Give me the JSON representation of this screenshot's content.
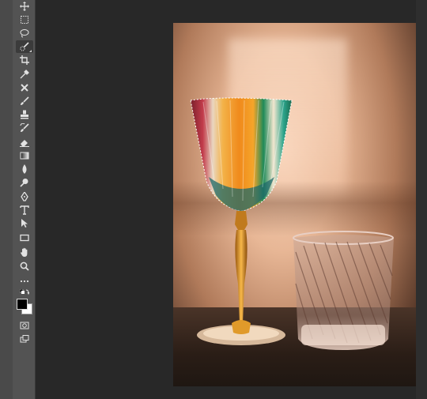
{
  "app": {
    "toolbar": {
      "tools": [
        {
          "name": "move-tool-icon",
          "glyph": "✥"
        },
        {
          "name": "rectangular-marquee-tool-icon",
          "glyph": "⬚"
        },
        {
          "name": "lasso-tool-icon",
          "glyph": "◌"
        },
        {
          "name": "quick-selection-tool-icon",
          "glyph": "✎",
          "active": true
        },
        {
          "name": "crop-tool-icon",
          "glyph": "⌗"
        },
        {
          "name": "eyedropper-tool-icon",
          "glyph": "⁄"
        },
        {
          "name": "spot-healing-brush-tool-icon",
          "glyph": "✗"
        },
        {
          "name": "brush-tool-icon",
          "glyph": "∕"
        },
        {
          "name": "clone-stamp-tool-icon",
          "glyph": "⊥"
        },
        {
          "name": "history-brush-tool-icon",
          "glyph": "↗"
        },
        {
          "name": "eraser-tool-icon",
          "glyph": "◆"
        },
        {
          "name": "gradient-tool-icon",
          "glyph": "▤"
        },
        {
          "name": "blur-tool-icon",
          "glyph": "●"
        },
        {
          "name": "dodge-tool-icon",
          "glyph": "⚲"
        },
        {
          "name": "pen-tool-icon",
          "glyph": "✒"
        },
        {
          "name": "type-tool-icon",
          "glyph": "T"
        },
        {
          "name": "path-selection-tool-icon",
          "glyph": "➚"
        },
        {
          "name": "rectangle-tool-icon",
          "glyph": "▭"
        },
        {
          "name": "hand-tool-icon",
          "glyph": "✋"
        },
        {
          "name": "zoom-tool-icon",
          "glyph": "⚲"
        },
        {
          "name": "edit-toolbar-icon",
          "glyph": "···"
        }
      ],
      "bottom_tools": [
        {
          "name": "quick-mask-icon",
          "glyph": "◙"
        },
        {
          "name": "screen-mode-icon",
          "glyph": "⧉"
        }
      ],
      "colors": {
        "foreground": "#000000",
        "background": "#ffffff"
      }
    },
    "canvas": {
      "background": "#282828"
    }
  }
}
